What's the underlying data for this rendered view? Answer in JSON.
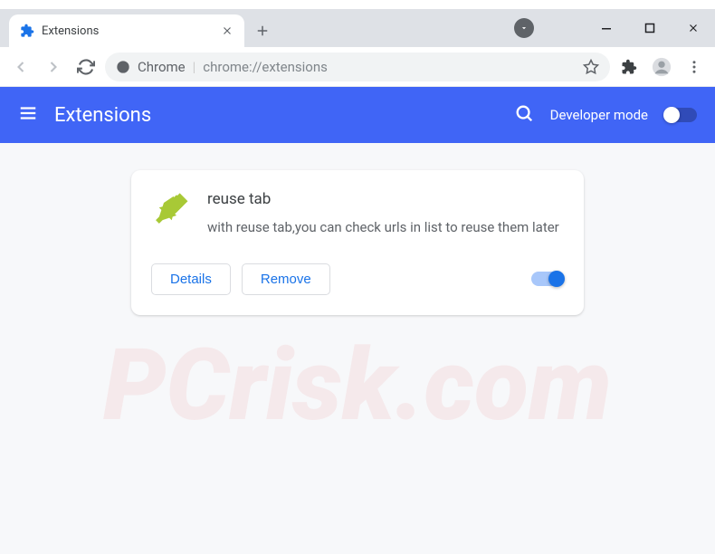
{
  "tab": {
    "title": "Extensions"
  },
  "omnibox": {
    "site_label": "Chrome",
    "url": "chrome://extensions"
  },
  "app_bar": {
    "title": "Extensions",
    "dev_mode_label": "Developer mode"
  },
  "extension": {
    "name": "reuse tab",
    "description": "with reuse tab,you can check urls in list to reuse them later",
    "details_label": "Details",
    "remove_label": "Remove",
    "enabled": true
  },
  "watermark": "PCrisk.com"
}
